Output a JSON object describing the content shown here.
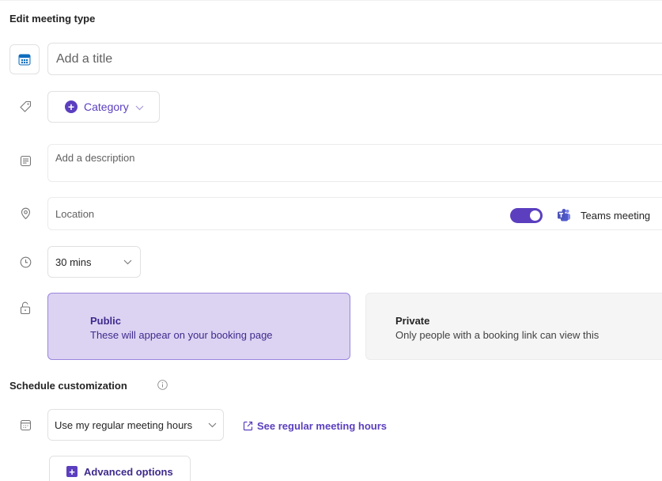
{
  "page": {
    "title": "Edit meeting type"
  },
  "title_field": {
    "placeholder": "Add a title",
    "icon": "calendar-icon"
  },
  "category": {
    "label": "Category",
    "icon": "tag-icon"
  },
  "description": {
    "placeholder": "Add a description",
    "icon": "notes-icon"
  },
  "location": {
    "placeholder": "Location",
    "icon": "location-pin-icon",
    "teams_toggle_on": true,
    "teams_label": "Teams meeting"
  },
  "duration": {
    "value": "30 mins",
    "icon": "clock-icon"
  },
  "visibility": {
    "icon": "unlock-icon",
    "public": {
      "title": "Public",
      "description": "These will appear on your booking page",
      "selected": true
    },
    "private": {
      "title": "Private",
      "description": "Only people with a booking link can view this",
      "selected": false
    }
  },
  "schedule": {
    "heading": "Schedule customization",
    "hours_value": "Use my regular meeting hours",
    "see_hours_link": "See regular meeting hours",
    "icon": "calendar-grid-icon"
  },
  "advanced": {
    "label": "Advanced options"
  },
  "colors": {
    "accent": "#5b3fbf",
    "public_bg": "#dcd3f3",
    "public_border": "#9a85dc"
  }
}
